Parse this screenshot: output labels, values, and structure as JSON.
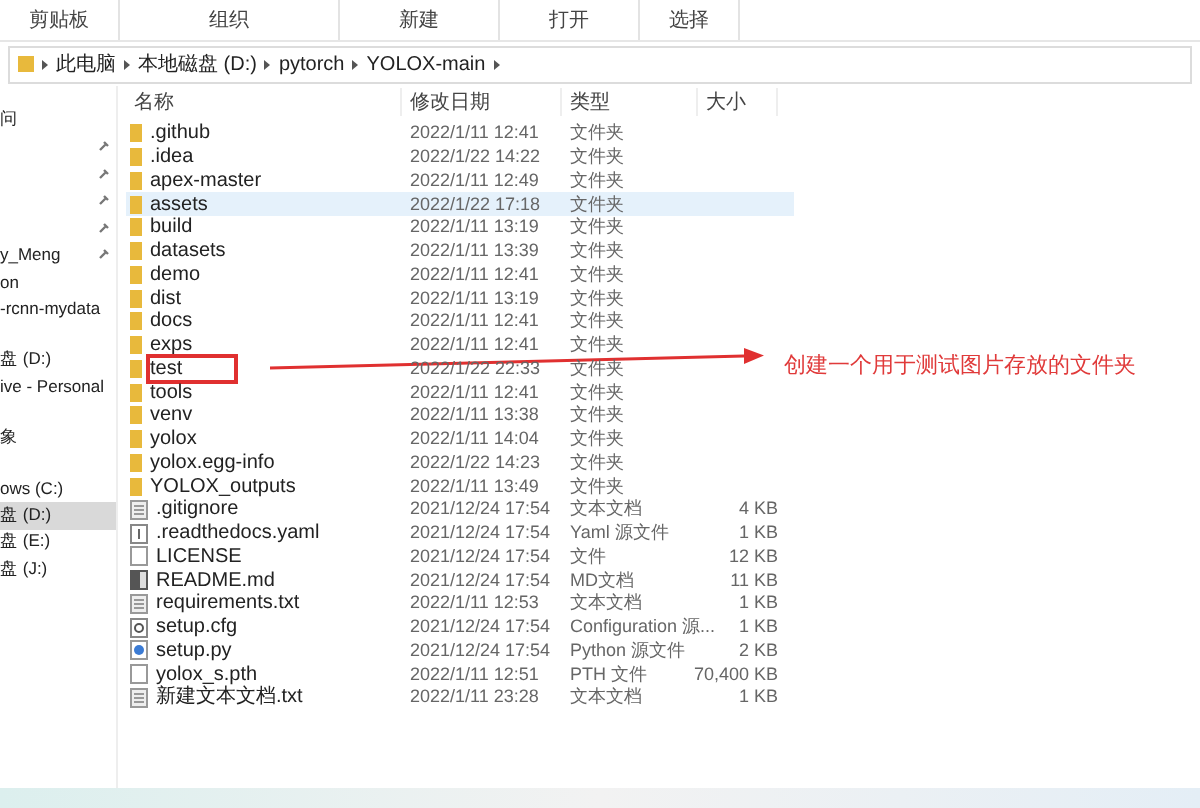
{
  "ribbon": {
    "groups": [
      "剪贴板",
      "组织",
      "新建",
      "打开",
      "选择"
    ]
  },
  "address": {
    "crumbs": [
      "此电脑",
      "本地磁盘 (D:)",
      "pytorch",
      "YOLOX-main"
    ]
  },
  "sidebar": {
    "groups": [
      {
        "items": [
          {
            "label": "问",
            "pinned": false,
            "selected": false
          },
          {
            "pinned": true,
            "selected": false
          },
          {
            "pinned": true,
            "selected": false
          },
          {
            "pinned": true,
            "selected": false
          },
          {
            "pinned": true,
            "selected": false
          },
          {
            "label": "y_Meng",
            "pinned": true,
            "selected": false
          },
          {
            "label": "on",
            "pinned": false,
            "selected": false
          },
          {
            "label": "-rcnn-mydata",
            "pinned": false,
            "selected": false
          }
        ]
      },
      {
        "items": [
          {
            "label": "盘 (D:)",
            "pinned": false,
            "selected": false
          },
          {
            "label": "ive - Personal",
            "pinned": false,
            "selected": false
          }
        ]
      },
      {
        "items": [
          {
            "label": "象",
            "pinned": false,
            "selected": false
          }
        ]
      },
      {
        "items": [
          {
            "label": "ows (C:)",
            "pinned": false,
            "selected": false
          },
          {
            "label": "盘 (D:)",
            "pinned": false,
            "selected": true
          },
          {
            "label": "盘 (E:)",
            "pinned": false,
            "selected": false
          },
          {
            "label": "盘 (J:)",
            "pinned": false,
            "selected": false
          }
        ]
      }
    ]
  },
  "table": {
    "columns": [
      "名称",
      "修改日期",
      "类型",
      "大小"
    ],
    "rows": [
      {
        "kind": "folder",
        "name": ".github",
        "date": "2022/1/11 12:41",
        "type": "文件夹",
        "selected": false
      },
      {
        "kind": "folder",
        "name": ".idea",
        "date": "2022/1/22 14:22",
        "type": "文件夹",
        "selected": false
      },
      {
        "kind": "folder",
        "name": "apex-master",
        "date": "2022/1/11 12:49",
        "type": "文件夹",
        "selected": false
      },
      {
        "kind": "folder",
        "name": "assets",
        "date": "2022/1/22 17:18",
        "type": "文件夹",
        "selected": true
      },
      {
        "kind": "folder",
        "name": "build",
        "date": "2022/1/11 13:19",
        "type": "文件夹",
        "selected": false
      },
      {
        "kind": "folder",
        "name": "datasets",
        "date": "2022/1/11 13:39",
        "type": "文件夹",
        "selected": false
      },
      {
        "kind": "folder",
        "name": "demo",
        "date": "2022/1/11 12:41",
        "type": "文件夹",
        "selected": false
      },
      {
        "kind": "folder",
        "name": "dist",
        "date": "2022/1/11 13:19",
        "type": "文件夹",
        "selected": false
      },
      {
        "kind": "folder",
        "name": "docs",
        "date": "2022/1/11 12:41",
        "type": "文件夹",
        "selected": false
      },
      {
        "kind": "folder",
        "name": "exps",
        "date": "2022/1/11 12:41",
        "type": "文件夹",
        "selected": false
      },
      {
        "kind": "folder",
        "name": "test",
        "date": "2022/1/22 22:33",
        "type": "文件夹",
        "selected": false,
        "marked": true
      },
      {
        "kind": "folder",
        "name": "tools",
        "date": "2022/1/11 12:41",
        "type": "文件夹",
        "selected": false
      },
      {
        "kind": "folder",
        "name": "venv",
        "date": "2022/1/11 13:38",
        "type": "文件夹",
        "selected": false
      },
      {
        "kind": "folder",
        "name": "yolox",
        "date": "2022/1/11 14:04",
        "type": "文件夹",
        "selected": false
      },
      {
        "kind": "folder",
        "name": "yolox.egg-info",
        "date": "2022/1/22 14:23",
        "type": "文件夹",
        "selected": false
      },
      {
        "kind": "folder",
        "name": "YOLOX_outputs",
        "date": "2022/1/11 13:49",
        "type": "文件夹",
        "selected": false
      },
      {
        "kind": "text",
        "name": ".gitignore",
        "date": "2021/12/24 17:54",
        "type": "文本文档",
        "size": "4 KB",
        "selected": false
      },
      {
        "kind": "yaml",
        "name": ".readthedocs.yaml",
        "date": "2021/12/24 17:54",
        "type": "Yaml 源文件",
        "size": "1 KB",
        "selected": false
      },
      {
        "kind": "file",
        "name": "LICENSE",
        "date": "2021/12/24 17:54",
        "type": "文件",
        "size": "12 KB",
        "selected": false
      },
      {
        "kind": "markdown",
        "name": "README.md",
        "date": "2021/12/24 17:54",
        "type": "MD文档",
        "size": "11 KB",
        "selected": false
      },
      {
        "kind": "text",
        "name": "requirements.txt",
        "date": "2022/1/11 12:53",
        "type": "文本文档",
        "size": "1 KB",
        "selected": false
      },
      {
        "kind": "config",
        "name": "setup.cfg",
        "date": "2021/12/24 17:54",
        "type": "Configuration 源...",
        "size": "1 KB",
        "selected": false
      },
      {
        "kind": "python",
        "name": "setup.py",
        "date": "2021/12/24 17:54",
        "type": "Python 源文件",
        "size": "2 KB",
        "selected": false
      },
      {
        "kind": "file",
        "name": "yolox_s.pth",
        "date": "2022/1/11 12:51",
        "type": "PTH 文件",
        "size": "70,400 KB",
        "selected": false
      },
      {
        "kind": "text",
        "name": "新建文本文档.txt",
        "date": "2022/1/11 23:28",
        "type": "文本文档",
        "size": "1 KB",
        "selected": false
      }
    ]
  },
  "annotation": {
    "text": "创建一个用于测试图片存放的文件夹"
  }
}
